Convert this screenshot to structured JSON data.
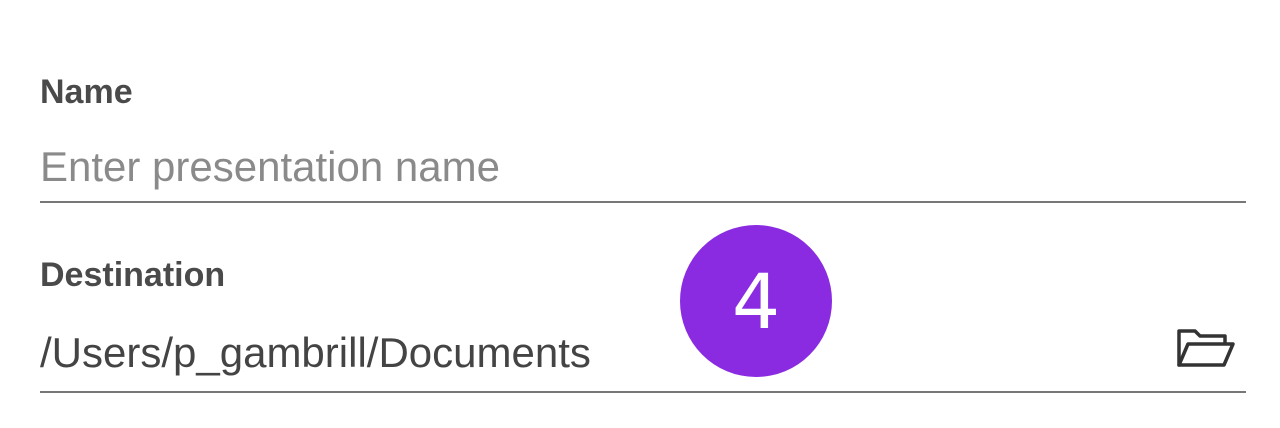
{
  "name_field": {
    "label": "Name",
    "value": "",
    "placeholder": "Enter presentation name"
  },
  "destination_field": {
    "label": "Destination",
    "value": "/Users/p_gambrill/Documents",
    "browse_icon": "folder-open-icon"
  },
  "step_badge": {
    "number": "4",
    "color": "#8a2be2"
  },
  "colors": {
    "label": "#4a4a4a",
    "text": "#444444",
    "placeholder": "#8a8a8a",
    "underline": "#777777"
  }
}
